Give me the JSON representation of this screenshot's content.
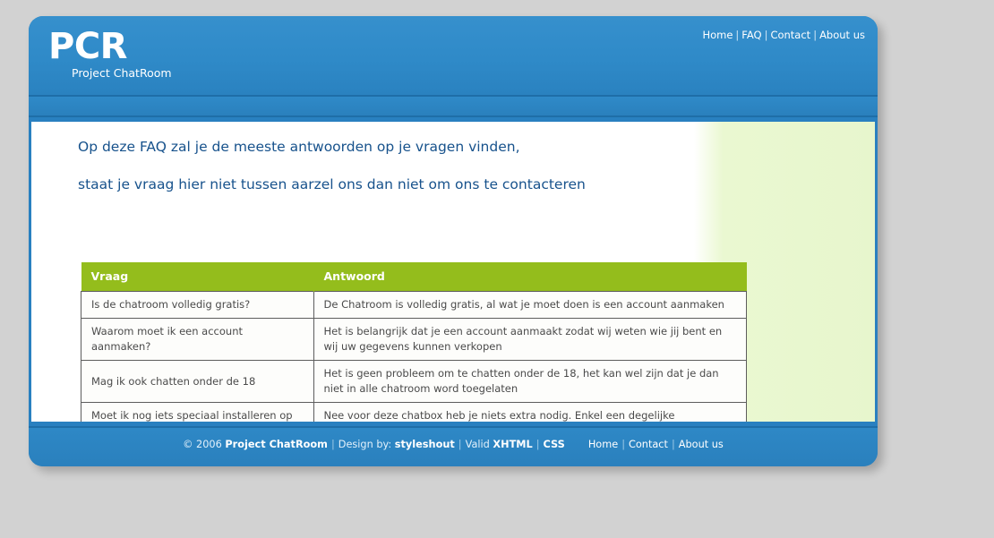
{
  "header": {
    "logo_main": "PCR",
    "logo_sub": "Project ChatRoom",
    "nav": [
      {
        "label": "Home"
      },
      {
        "label": "FAQ"
      },
      {
        "label": "Contact"
      },
      {
        "label": "About us"
      }
    ],
    "nav_separator": "|"
  },
  "main": {
    "intro_line_1": "Op deze FAQ zal je de meeste antwoorden op je vragen vinden,",
    "intro_line_2": "staat je vraag hier niet tussen aarzel ons dan niet om ons te contacteren",
    "table": {
      "headers": [
        "Vraag",
        "Antwoord"
      ],
      "rows": [
        {
          "question": "Is de chatroom volledig gratis?",
          "answer": "De Chatroom is volledig gratis, al wat je moet doen is een account aanmaken"
        },
        {
          "question": "Waarom moet ik een account aanmaken?",
          "answer": "Het is belangrijk dat je een account aanmaakt zodat wij weten wie jij bent en wij uw gegevens kunnen verkopen"
        },
        {
          "question": "Mag ik ook chatten onder de 18",
          "answer": "Het is geen probleem om te chatten onder de 18, het kan wel zijn dat je dan niet in alle chatroom word toegelaten"
        },
        {
          "question": "Moet ik nog iets speciaal installeren op mijn computer",
          "answer": "Nee voor deze chatbox heb je niets extra nodig. Enkel een degelijke webbrowser zoals firefox, geen MS rommel dus"
        }
      ]
    }
  },
  "footer": {
    "copyright": "© 2006",
    "site_name": "Project ChatRoom",
    "design_by_label": "Design by:",
    "designer": "styleshout",
    "valid_label": "Valid",
    "valid_xhtml": "XHTML",
    "valid_css": "CSS",
    "separator": "|",
    "nav": [
      {
        "label": "Home"
      },
      {
        "label": "Contact"
      },
      {
        "label": "About us"
      }
    ]
  },
  "colors": {
    "page_background": "#d2d2d2",
    "brand_blue": "#2980c0",
    "header_blue": "#3690cd",
    "border_blue": "#1e6ea8",
    "table_header_green": "#94bd1c",
    "sidebar_green": "#e7f6cd",
    "heading_text": "#17528c",
    "body_text": "#4a4a4a",
    "white": "#ffffff"
  }
}
